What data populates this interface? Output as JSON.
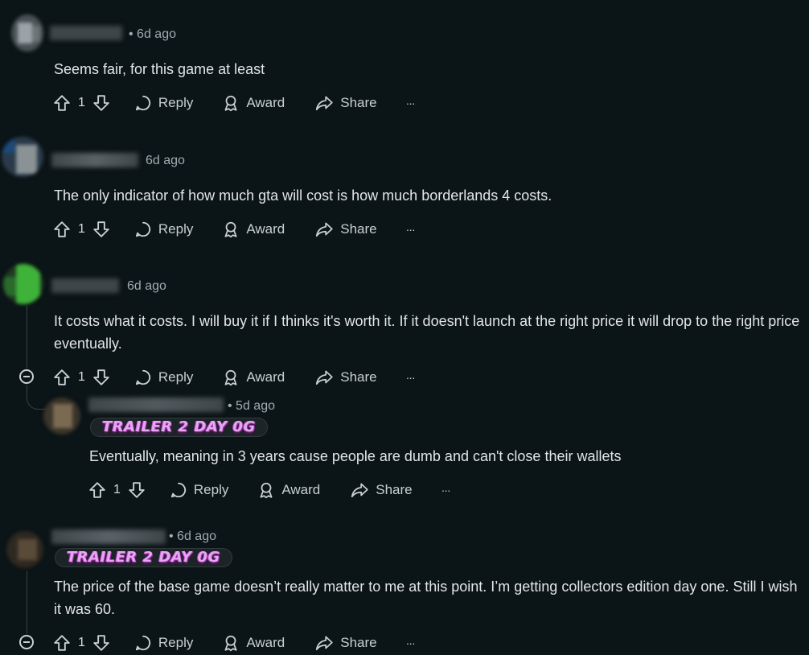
{
  "action_labels": {
    "reply": "Reply",
    "award": "Award",
    "share": "Share",
    "more": "···"
  },
  "comments": [
    {
      "time": "• 6d ago",
      "text": "Seems fair, for this game at least",
      "upvotes": "1"
    },
    {
      "time": "6d ago",
      "text": "The only indicator of how much gta will cost is how much borderlands 4 costs.",
      "upvotes": "1"
    },
    {
      "time": "6d ago",
      "text": "It costs what it costs. I will buy it if I thinks it's worth it. If it doesn't launch at the right price it will drop to the right price eventually.",
      "upvotes": "1"
    },
    {
      "time": "• 5d ago",
      "flair": "TRAILER 2 DAY 0G",
      "text": "Eventually, meaning in 3 years cause people are dumb and can't close their wallets",
      "upvotes": "1"
    },
    {
      "time": "• 6d ago",
      "flair": "TRAILER 2 DAY 0G",
      "text": "The price of the base game doesn’t really matter to me at this point. I’m getting collectors edition day one. Still I wish it was 60.",
      "upvotes": "1"
    }
  ],
  "colors": {
    "background": "#0b1416",
    "text": "#d7dadc",
    "muted": "#a0acb1",
    "flair": "#e3a8f0"
  }
}
